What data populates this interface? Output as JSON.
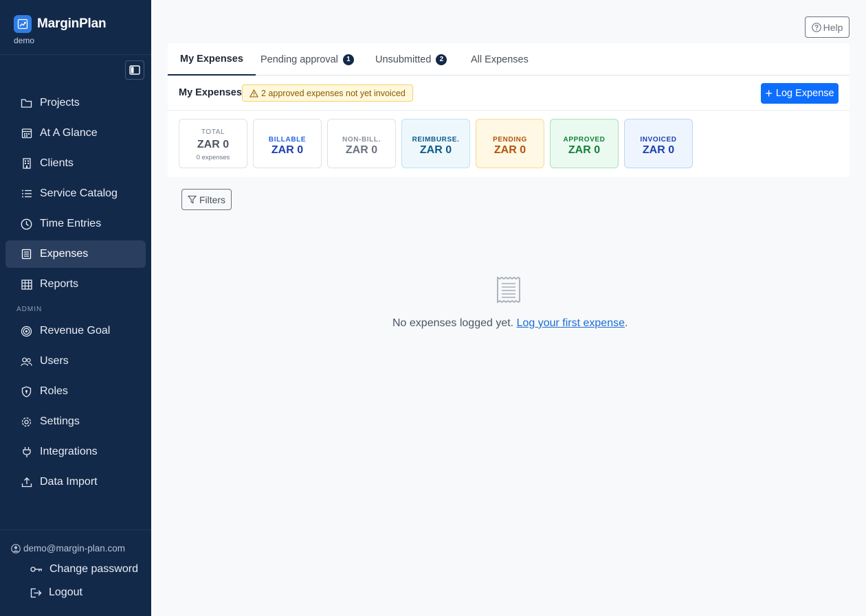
{
  "brand": {
    "name": "MarginPlan",
    "workspace": "demo"
  },
  "sidebar": {
    "items": [
      {
        "label": "Projects",
        "icon": "folder-icon"
      },
      {
        "label": "At A Glance",
        "icon": "calendar-grid-icon"
      },
      {
        "label": "Clients",
        "icon": "building-icon"
      },
      {
        "label": "Service Catalog",
        "icon": "list-icon"
      },
      {
        "label": "Time Entries",
        "icon": "clock-icon"
      },
      {
        "label": "Expenses",
        "icon": "receipt-icon",
        "active": true
      },
      {
        "label": "Reports",
        "icon": "table-icon"
      }
    ],
    "admin_heading": "ADMIN",
    "admin_items": [
      {
        "label": "Revenue Goal",
        "icon": "target-icon"
      },
      {
        "label": "Users",
        "icon": "users-icon"
      },
      {
        "label": "Roles",
        "icon": "shield-icon"
      },
      {
        "label": "Settings",
        "icon": "gear-icon"
      },
      {
        "label": "Integrations",
        "icon": "plug-icon"
      },
      {
        "label": "Data Import",
        "icon": "upload-icon"
      }
    ]
  },
  "user": {
    "email": "demo@margin-plan.com",
    "change_password": "Change password",
    "logout": "Logout"
  },
  "header": {
    "help": "Help"
  },
  "tabs": [
    {
      "label": "My Expenses",
      "active": true
    },
    {
      "label": "Pending approval",
      "badge": "1"
    },
    {
      "label": "Unsubmitted",
      "badge": "2"
    },
    {
      "label": "All Expenses"
    }
  ],
  "toolbar": {
    "title": "My Expenses",
    "warning": "2 approved expenses not yet invoiced",
    "log_button": "Log Expense"
  },
  "stats": [
    {
      "label": "TOTAL",
      "value": "ZAR 0",
      "sub": "0 expenses"
    },
    {
      "label": "BILLABLE",
      "value": "ZAR 0"
    },
    {
      "label": "NON-BILL.",
      "value": "ZAR 0"
    },
    {
      "label": "REIMBURSE.",
      "value": "ZAR 0"
    },
    {
      "label": "PENDING",
      "value": "ZAR 0"
    },
    {
      "label": "APPROVED",
      "value": "ZAR 0"
    },
    {
      "label": "INVOICED",
      "value": "ZAR 0"
    }
  ],
  "filters": {
    "label": "Filters"
  },
  "empty_state": {
    "message": "No expenses logged yet.",
    "link": "Log your first expense",
    "suffix": "."
  },
  "colors": {
    "sidebar_bg": "#13294a",
    "accent": "#0d6efd",
    "billable": "#2563eb",
    "reimburse": "#0e5a8a",
    "pending": "#b45309",
    "approved": "#15803d",
    "invoiced": "#1e40af"
  }
}
